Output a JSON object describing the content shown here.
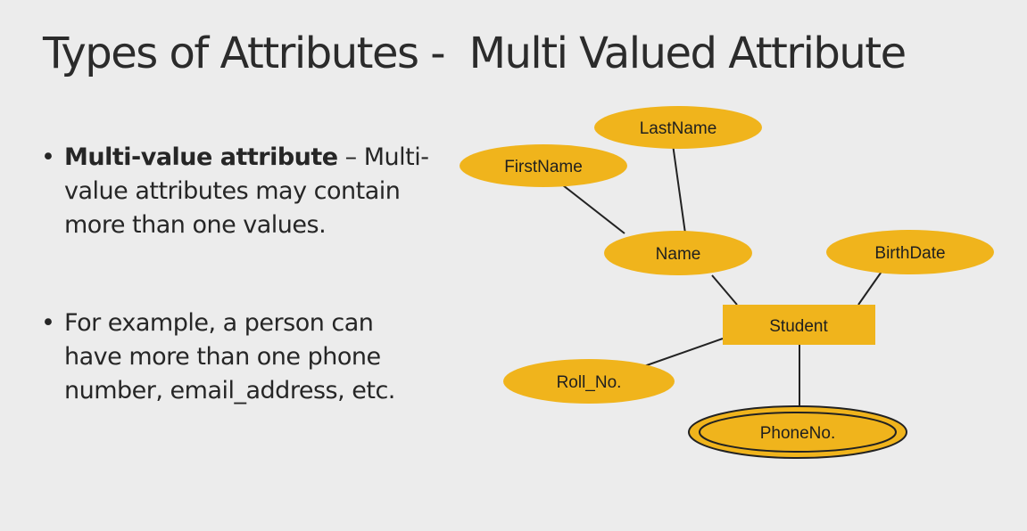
{
  "slide": {
    "title": "Types of Attributes -  Multi Valued Attribute"
  },
  "bullets": [
    {
      "marker": "•",
      "term": "Multi-value attribute",
      "separator": " – ",
      "text": "Multi-value attributes may contain more than one values."
    },
    {
      "marker": "•",
      "text": "For example, a person can have more than one phone number, email_address, etc."
    }
  ],
  "diagram": {
    "entity": {
      "label": "Student"
    },
    "attributes": {
      "lastname": "LastName",
      "firstname": "FirstName",
      "name": "Name",
      "birthdate": "BirthDate",
      "rollno": "Roll_No.",
      "phoneno": "PhoneNo."
    },
    "colors": {
      "attribute_fill": "#f0b41c",
      "entity_fill": "#f0b41c",
      "line": "#222222",
      "background": "#ececec"
    }
  }
}
